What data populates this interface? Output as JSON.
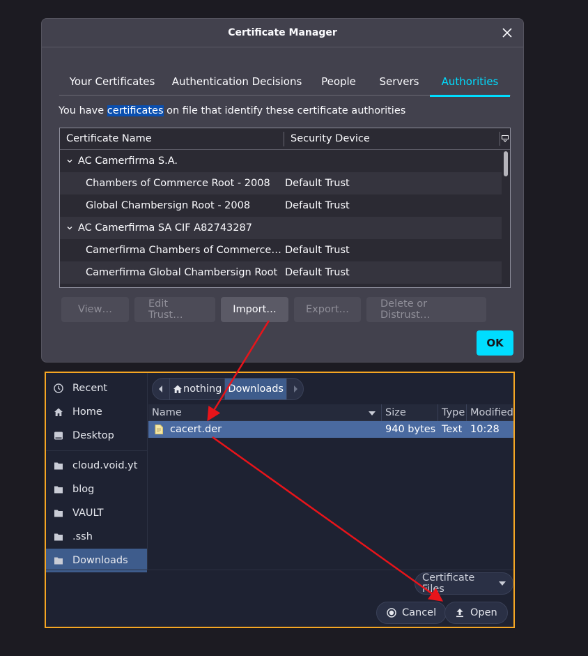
{
  "cert_manager": {
    "title": "Certificate Manager",
    "tabs": [
      {
        "label": "Your Certificates",
        "active": false
      },
      {
        "label": "Authentication Decisions",
        "active": false
      },
      {
        "label": "People",
        "active": false
      },
      {
        "label": "Servers",
        "active": false
      },
      {
        "label": "Authorities",
        "active": true
      }
    ],
    "intro_before": "You have ",
    "intro_highlight": "certificates",
    "intro_after": " on file that identify these certificate authorities",
    "columns": {
      "name": "Certificate Name",
      "device": "Security Device"
    },
    "rows": [
      {
        "type": "group",
        "name": "AC Camerfirma S.A.",
        "device": ""
      },
      {
        "type": "child",
        "name": "Chambers of Commerce Root - 2008",
        "device": "Default Trust"
      },
      {
        "type": "child",
        "name": "Global Chambersign Root - 2008",
        "device": "Default Trust"
      },
      {
        "type": "group",
        "name": "AC Camerfirma SA CIF A82743287",
        "device": ""
      },
      {
        "type": "child",
        "name": "Camerfirma Chambers of Commerce Root",
        "device": "Default Trust"
      },
      {
        "type": "child",
        "name": "Camerfirma Global Chambersign Root",
        "device": "Default Trust"
      }
    ],
    "buttons": {
      "view": "View…",
      "edit_trust": "Edit Trust…",
      "import": "Import…",
      "export": "Export…",
      "delete": "Delete or Distrust…"
    },
    "ok": "OK",
    "accent_color": "#00ddff"
  },
  "file_chooser": {
    "places": {
      "recent": "Recent",
      "home": "Home",
      "desktop": "Desktop",
      "bookmarks": [
        "cloud.void.yt",
        "blog",
        "VAULT",
        ".ssh",
        "Downloads"
      ]
    },
    "path": {
      "home": "nothing",
      "current": "Downloads"
    },
    "columns": {
      "name": "Name",
      "size": "Size",
      "type": "Type",
      "modified": "Modified"
    },
    "files": [
      {
        "name": "cacert.der",
        "size": "940 bytes",
        "type": "Text",
        "modified": "10:28"
      }
    ],
    "filter": "Certificate Files",
    "cancel": "Cancel",
    "open": "Open",
    "border_color": "#f5a623"
  },
  "annotation_color": "#e8141a"
}
